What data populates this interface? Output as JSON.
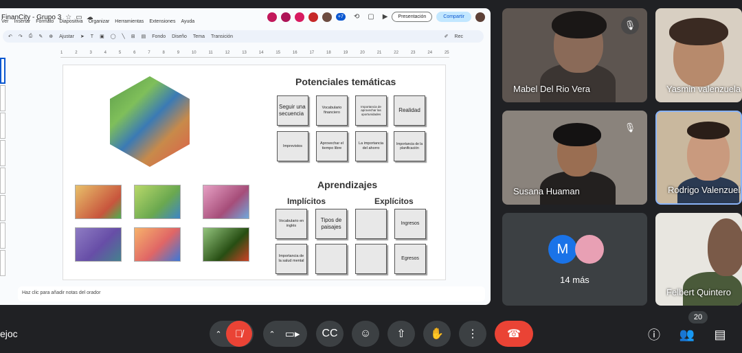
{
  "slides_app": {
    "doc_title": "FinanCity - Grupo 3",
    "menu": [
      "Ver",
      "Insertar",
      "Formato",
      "Diapositiva",
      "Organizar",
      "Herramientas",
      "Extensiones",
      "Ayuda"
    ],
    "collab_badge": "+7",
    "present_label": "Presentación",
    "share_label": "Compartir",
    "toolbar": {
      "zoom": "Ajustar",
      "fondo": "Fondo",
      "diseno": "Diseño",
      "tema": "Tema",
      "transicion": "Transición",
      "rec": "Rec"
    },
    "ruler_ticks": [
      "1",
      "2",
      "3",
      "4",
      "5",
      "6",
      "7",
      "8",
      "9",
      "10",
      "11",
      "12",
      "13",
      "14",
      "15",
      "16",
      "17",
      "18",
      "19",
      "20",
      "21",
      "22",
      "23",
      "24",
      "25"
    ],
    "notes_placeholder": "Haz clic para añadir notas del orador"
  },
  "slide": {
    "title_potenciales": "Potenciales temáticas",
    "title_aprendizajes": "Aprendizajes",
    "col_implicitos": "Implícitos",
    "col_explicitos": "Explícitos",
    "potenciales_cards": [
      "Seguir una secuencia",
      "Vocabulario financiero",
      "Importancia de aprovechar las oportunidades",
      "Realidad",
      "Imprevistos",
      "Aprovechar el tiempo libre",
      "La importancia del ahorro",
      "Importancia de la planificación"
    ],
    "implicitos_cards": [
      "Vocabulario en inglés",
      "Tipos de paisajes",
      "Importancia de la salud mental",
      ""
    ],
    "explicitos_cards": [
      "",
      "Ingresos",
      "",
      "Egresos"
    ]
  },
  "participants": [
    {
      "name": "Mabel Del Rio Vera",
      "muted": true
    },
    {
      "name": "Yasmin valenzuela",
      "muted": false
    },
    {
      "name": "Susana Huaman",
      "muted": true
    },
    {
      "name": "Rodrigo Valenzuela",
      "muted": false
    },
    {
      "name": "Felbert Quintero",
      "muted": false
    }
  ],
  "more_tile": {
    "avatar_letter": "M",
    "label": "14 más"
  },
  "bottom_bar": {
    "meeting_code": "ejoc",
    "participant_count": "20"
  },
  "colors": {
    "meet_bg": "#202124",
    "tile_bg": "#3c4043",
    "red": "#ea4335",
    "active_speaker": "#8ab4f8",
    "accent_blue": "#0b57d0"
  }
}
